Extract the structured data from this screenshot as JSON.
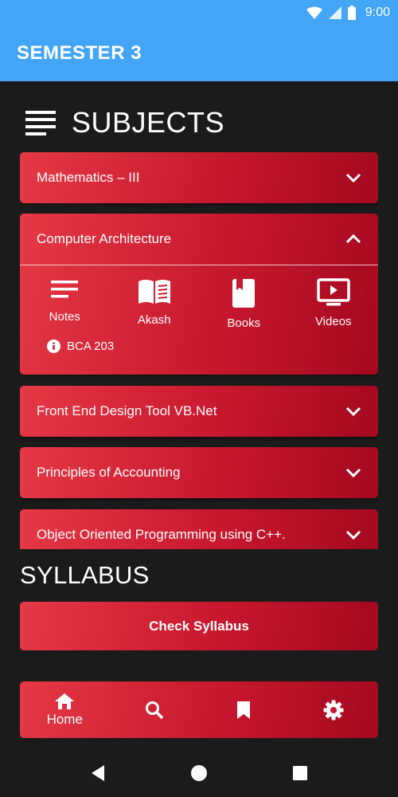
{
  "status_bar": {
    "time": "9:00",
    "color": "#42a5f5"
  },
  "app_bar": {
    "title": "SEMESTER 3"
  },
  "subjects": {
    "heading": "SUBJECTS",
    "items": [
      {
        "name": "Mathematics – III",
        "expanded": false
      },
      {
        "name": "Computer Architecture",
        "expanded": true,
        "actions": [
          {
            "label": "Notes",
            "icon": "notes-icon"
          },
          {
            "label": "Akash",
            "icon": "open-book-icon"
          },
          {
            "label": "Books",
            "icon": "book-icon"
          },
          {
            "label": "Videos",
            "icon": "video-icon"
          }
        ],
        "code": "BCA 203"
      },
      {
        "name": "Front End Design Tool VB.Net",
        "expanded": false
      },
      {
        "name": "Principles of Accounting",
        "expanded": false
      },
      {
        "name": "Object Oriented Programming using C++.",
        "expanded": false
      }
    ]
  },
  "syllabus": {
    "heading": "SYLLABUS",
    "button_label": "Check Syllabus"
  },
  "bottom_nav": {
    "items": [
      {
        "icon": "home-icon",
        "label": "Home"
      },
      {
        "icon": "search-icon",
        "label": ""
      },
      {
        "icon": "bookmark-icon",
        "label": ""
      },
      {
        "icon": "settings-icon",
        "label": ""
      }
    ]
  },
  "theme": {
    "accent": "#42a5f5",
    "card_red": "#d81f35",
    "background": "#1b1b1b"
  }
}
